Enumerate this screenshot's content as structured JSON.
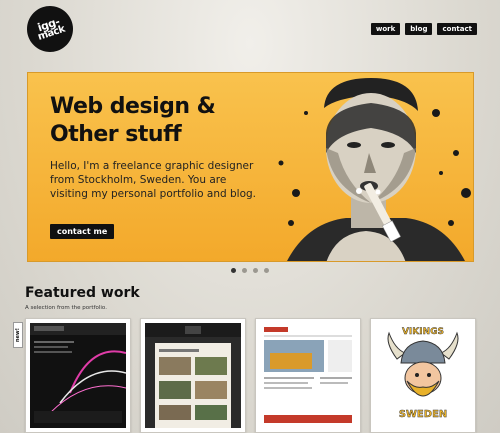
{
  "logo": {
    "line1": "igg-",
    "line2": "mack"
  },
  "nav": {
    "items": [
      "work",
      "blog",
      "contact"
    ]
  },
  "hero": {
    "title_line1": "Web design &",
    "title_line2": "Other stuff",
    "body": "Hello, I'm a freelance graphic designer from Stockholm, Sweden. You are visiting my personal portfolio and blog.",
    "cta": "contact me"
  },
  "slider": {
    "count": 4,
    "active": 1
  },
  "featured": {
    "title": "Featured work",
    "subtitle": "A selection from the portfolio.",
    "badge": "new!",
    "thumb4_top": "VIKINGS",
    "thumb4_bottom": "SWEDEN"
  },
  "colors": {
    "hero_bg": "#f6b43a",
    "text": "#111111"
  }
}
